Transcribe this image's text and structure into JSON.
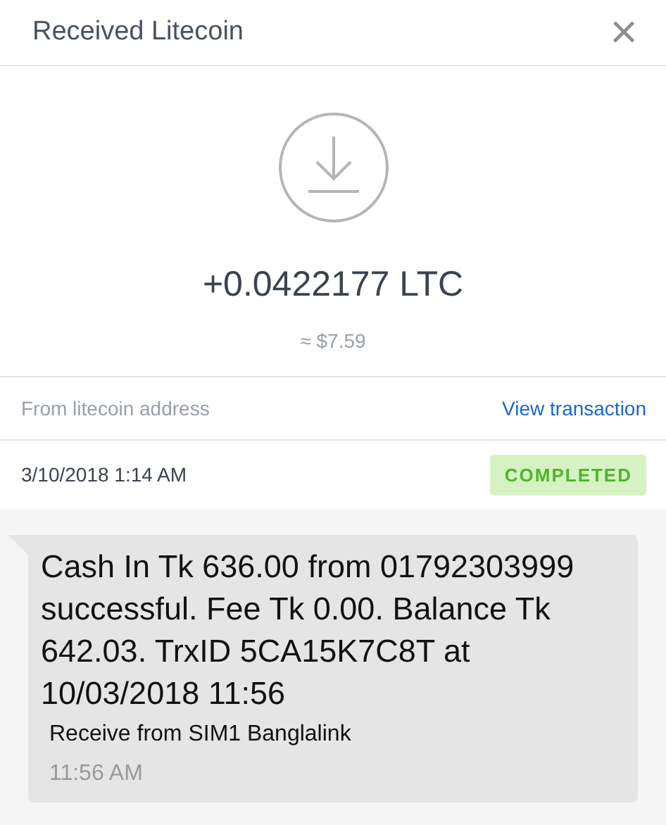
{
  "dialog": {
    "title": "Received Litecoin",
    "close": "×"
  },
  "amount": "+0.0422177 LTC",
  "fiat_value": "≈ $7.59",
  "source": {
    "label": "From litecoin address",
    "link": "View transaction"
  },
  "date": "3/10/2018 1:14 AM",
  "status": "COMPLETED",
  "sms": {
    "text": "Cash In Tk 636.00 from 01792303999 successful. Fee Tk 0.00. Balance Tk 642.03. TrxID 5CA15K7C8T at 10/03/2018 11:56",
    "sender": "Receive from SIM1 Banglalink",
    "time": "11:56 AM"
  }
}
